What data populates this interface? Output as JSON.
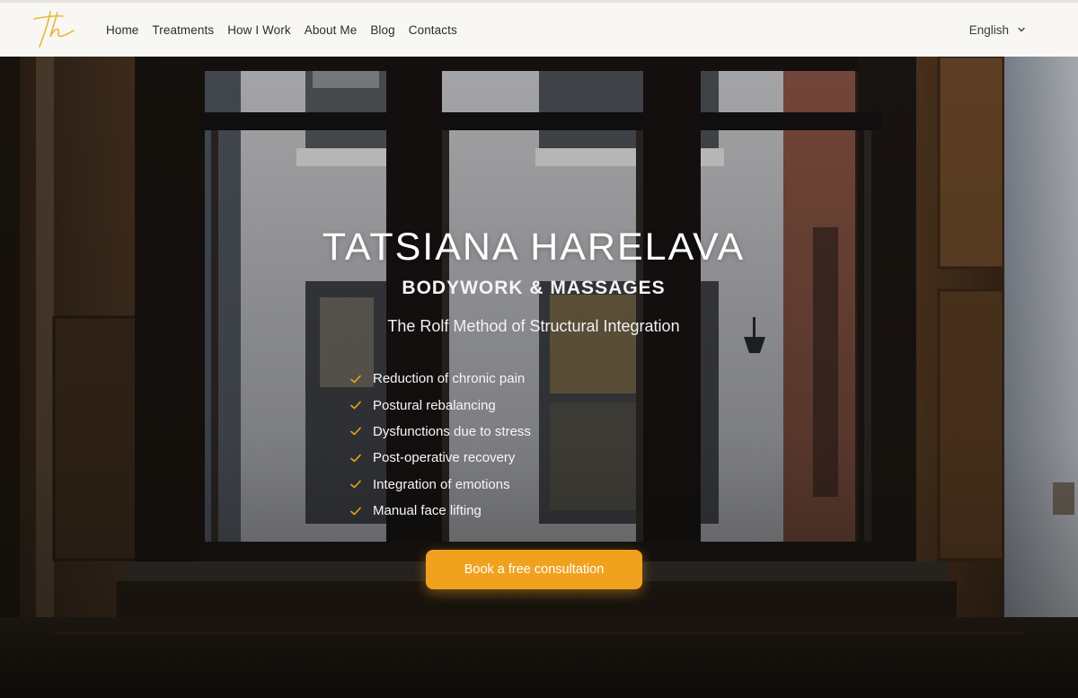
{
  "header": {
    "logo_text": "th",
    "nav": [
      "Home",
      "Treatments",
      "How I Work",
      "About Me",
      "Blog",
      "Contacts"
    ],
    "language": "English"
  },
  "hero": {
    "title": "TATSIANA HARELAVA",
    "subtitle": "BODYWORK & MASSAGES",
    "method": "The Rolf Method of Structural Integration",
    "benefits": [
      "Reduction of chronic pain",
      "Postural rebalancing",
      "Dysfunctions due to stress",
      "Post-operative recovery",
      "Integration of emotions",
      "Manual face lifting"
    ],
    "cta_label": "Book a free consultation"
  },
  "icons": {
    "logo": "signature-logo-icon",
    "language_dropdown": "chevron-down-icon",
    "bullet": "check-icon"
  },
  "colors": {
    "accent": "#f0a21f",
    "header_bg": "#f8f7f3",
    "nav_text": "#2c2c2c",
    "logo": "#e7b93a"
  }
}
